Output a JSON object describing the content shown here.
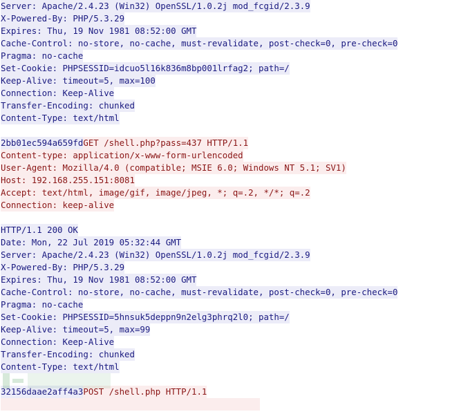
{
  "window": {
    "type": "follow-tcp-stream",
    "colors": {
      "server_text": "#1a1a80",
      "server_bg": "#ececf8",
      "client_text": "#8a1515",
      "client_bg": "#fbeded"
    }
  },
  "stream": {
    "block1_response": [
      "Server: Apache/2.4.23 (Win32) OpenSSL/1.0.2j mod_fcgid/2.3.9",
      "X-Powered-By: PHP/5.3.29",
      "Expires: Thu, 19 Nov 1981 08:52:00 GMT",
      "Cache-Control: no-store, no-cache, must-revalidate, post-check=0, pre-check=0",
      "Pragma: no-cache",
      "Set-Cookie: PHPSESSID=idcuo5l16k836m8bp001lrfag2; path=/",
      "Keep-Alive: timeout=5, max=100",
      "Connection: Keep-Alive",
      "Transfer-Encoding: chunked",
      "Content-Type: text/html"
    ],
    "block2_request": {
      "chunk_prefix": "2bb01ec594a659fd",
      "request_line": "GET /shell.php?pass=437 HTTP/1.1",
      "headers": [
        "Content-type: application/x-www-form-urlencoded",
        "User-Agent: Mozilla/4.0 (compatible; MSIE 6.0; Windows NT 5.1; SV1)",
        "Host: 192.168.255.151:8081",
        "Accept: text/html, image/gif, image/jpeg, *; q=.2, */*; q=.2",
        "Connection: keep-alive"
      ]
    },
    "block3_response": [
      "HTTP/1.1 200 OK",
      "Date: Mon, 22 Jul 2019 05:32:44 GMT",
      "Server: Apache/2.4.23 (Win32) OpenSSL/1.0.2j mod_fcgid/2.3.9",
      "X-Powered-By: PHP/5.3.29",
      "Expires: Thu, 19 Nov 1981 08:52:00 GMT",
      "Cache-Control: no-store, no-cache, must-revalidate, post-check=0, pre-check=0",
      "Pragma: no-cache",
      "Set-Cookie: PHPSESSID=5hnsuk5deppn9n2elg3phrq2l0; path=/",
      "Keep-Alive: timeout=5, max=99",
      "Connection: Keep-Alive",
      "Transfer-Encoding: chunked",
      "Content-Type: text/html"
    ],
    "block4_request": {
      "chunk_prefix": "32156daae2aff4a3",
      "request_line": "POST /shell.php HTTP/1.1"
    }
  }
}
